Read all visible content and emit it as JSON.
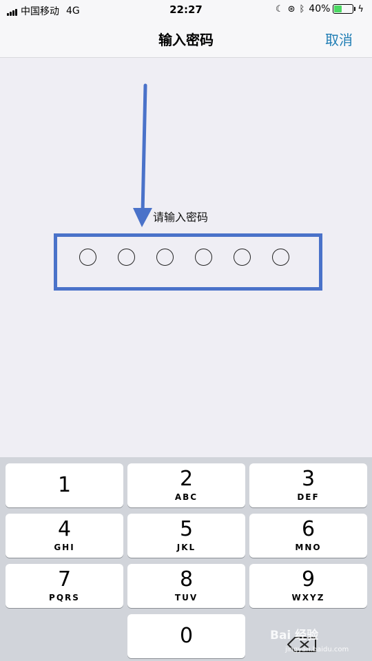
{
  "status_bar": {
    "carrier": "中国移动",
    "network": "4G",
    "time": "22:27",
    "battery_percent": "40%",
    "battery_level": 0.4,
    "icons": [
      "moon-icon",
      "rotation-lock-icon",
      "bluetooth-icon",
      "charging-icon"
    ]
  },
  "nav": {
    "title": "输入密码",
    "cancel_label": "取消"
  },
  "content": {
    "prompt": "请输入密码",
    "dot_count": 6
  },
  "keypad": {
    "keys": [
      {
        "num": "1",
        "letters": ""
      },
      {
        "num": "2",
        "letters": "ABC"
      },
      {
        "num": "3",
        "letters": "DEF"
      },
      {
        "num": "4",
        "letters": "GHI"
      },
      {
        "num": "5",
        "letters": "JKL"
      },
      {
        "num": "6",
        "letters": "MNO"
      },
      {
        "num": "7",
        "letters": "PQRS"
      },
      {
        "num": "8",
        "letters": "TUV"
      },
      {
        "num": "9",
        "letters": "WXYZ"
      },
      {
        "num": "0",
        "letters": ""
      }
    ]
  },
  "watermark": {
    "text": "Bai 经验",
    "sub": "jingyan.baidu.com"
  },
  "colors": {
    "accent": "#1f7db4",
    "annotation": "#4a72c9",
    "battery": "#4cd964"
  }
}
